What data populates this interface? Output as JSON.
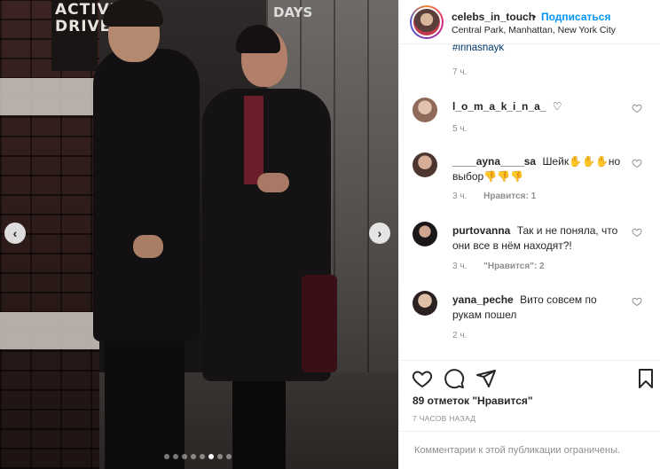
{
  "photo": {
    "sign_text": "ACTIVE DRIVE",
    "door_text": "DAYS",
    "carousel_total": 8,
    "carousel_active_index": 5
  },
  "header": {
    "username": "celebs_in_touch",
    "separator": "•",
    "follow_label": "Подписаться",
    "location": "Central Park, Manhattan, New York City"
  },
  "caption_tail": {
    "hashtag": "#irinashayk",
    "time": "7 ч."
  },
  "comments": [
    {
      "user": "l_o_m_a_k_i_n_a_",
      "text": "♡",
      "time": "5 ч.",
      "likes": ""
    },
    {
      "user": "____ayna____sa",
      "text": "Шейк✋✋✋но выбор👎👎👎",
      "time": "3 ч.",
      "likes": "Нравится: 1"
    },
    {
      "user": "purtovanna",
      "text": "Так и не поняла, что они все в нём находят?!",
      "time": "3 ч.",
      "likes": "\"Нравится\": 2"
    },
    {
      "user": "yana_peche",
      "text": "Вито совсем по рукам пошел",
      "time": "2 ч.",
      "likes": ""
    }
  ],
  "footer": {
    "likes_text": "89 отметок \"Нравится\"",
    "post_time": "7 ЧАСОВ НАЗАД",
    "comments_closed": "Комментарии к этой публикации ограничены."
  },
  "icons": {
    "like": "heart-icon",
    "comment": "comment-icon",
    "share": "share-icon",
    "save": "bookmark-icon"
  },
  "colors": {
    "link_blue": "#0095f6",
    "hashtag_blue": "#00376b",
    "muted_gray": "#8e8e8e",
    "text": "#262626"
  }
}
